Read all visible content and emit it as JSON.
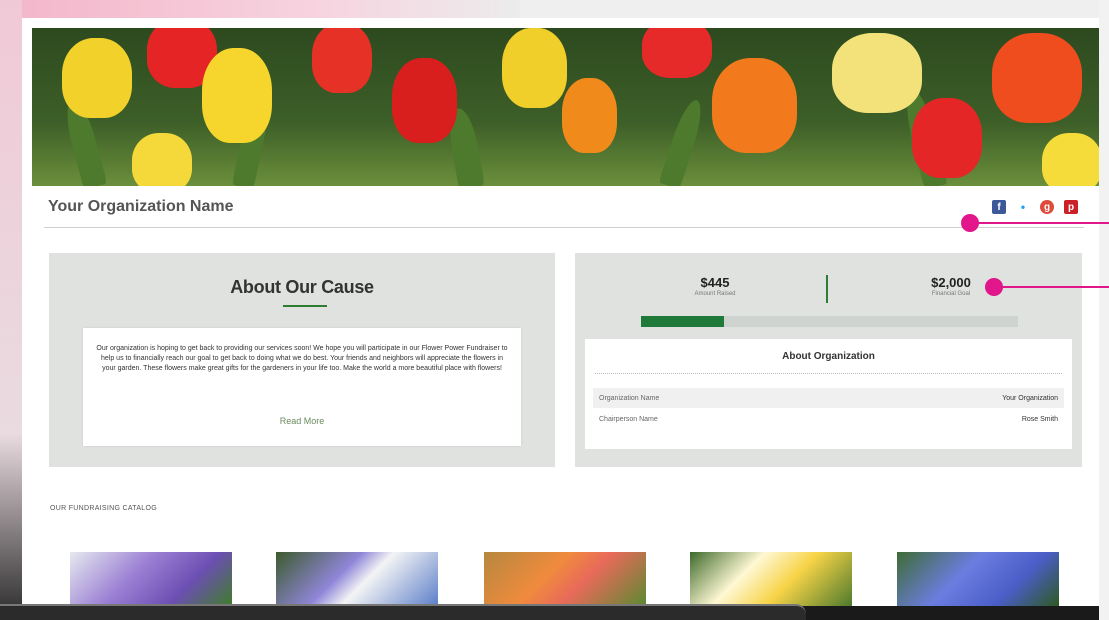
{
  "org": {
    "name": "Your Organization Name"
  },
  "social": [
    {
      "name": "facebook-icon",
      "glyph": "f"
    },
    {
      "name": "twitter-icon",
      "glyph": "•"
    },
    {
      "name": "google-plus-icon",
      "glyph": "g"
    },
    {
      "name": "pinterest-icon",
      "glyph": "p"
    }
  ],
  "about": {
    "title": "About Our Cause",
    "text": "Our organization is hoping to get back to providing our services soon! We hope you will participate in our Flower Power Fundraiser to help us to financially reach our goal to get back to doing what we do best. Your friends and neighbors will appreciate the flowers in your garden. These flowers make great gifts for the gardeners in your life too. Make the world a more beautiful place with flowers!",
    "read_more": "Read More"
  },
  "stats": {
    "raised_value": "$445",
    "raised_label": "Amount Raised",
    "goal_value": "$2,000",
    "goal_label": "Financial Goal",
    "progress_fraction": 0.22
  },
  "about_org": {
    "title": "About Organization",
    "rows": [
      {
        "key": "Organization Name",
        "value": "Your Organization"
      },
      {
        "key": "Chairperson Name",
        "value": "Rose Smith"
      }
    ]
  },
  "catalog": {
    "title": "OUR FUNDRAISING CATALOG",
    "items": [
      "allium",
      "anemone",
      "lily",
      "daffodil",
      "hyacinth"
    ]
  },
  "colors": {
    "accent_green": "#1f7a3a",
    "callout_magenta": "#e0168a",
    "panel_gray": "#dfe2df"
  }
}
